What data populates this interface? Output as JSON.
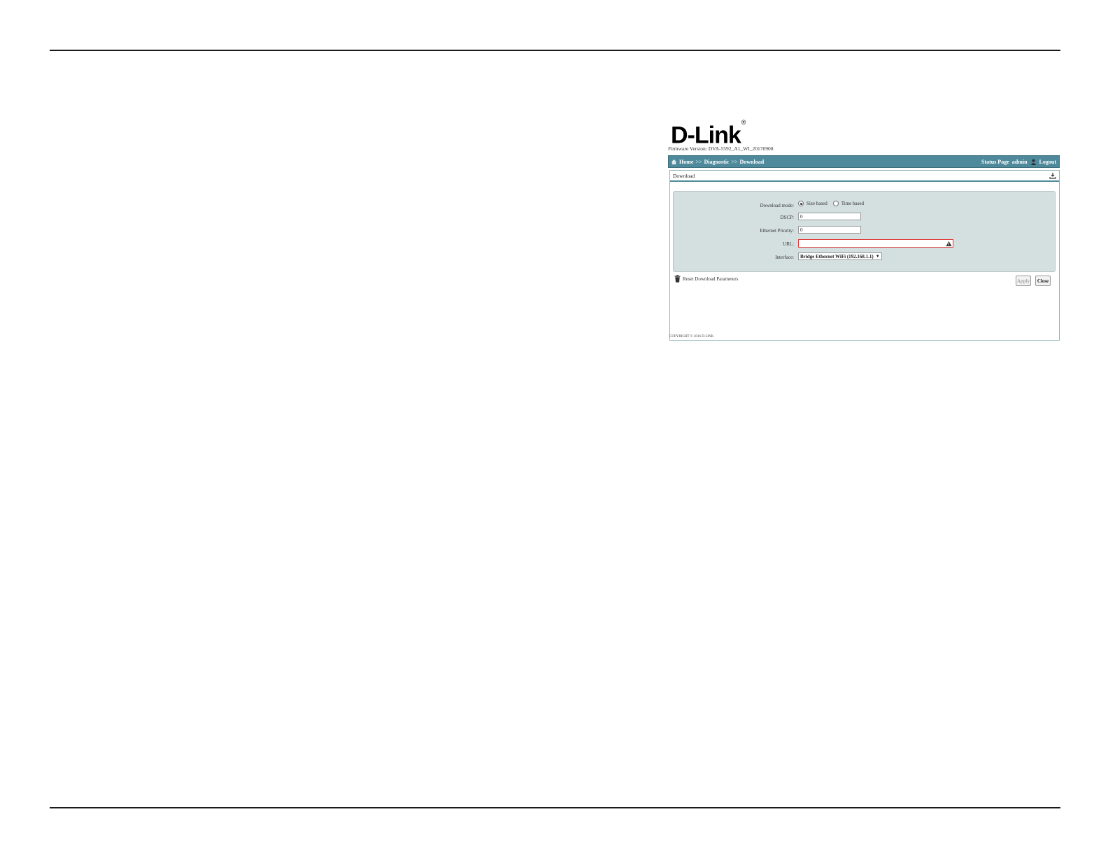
{
  "brand": {
    "logo_text": "D-Link",
    "registered_mark": "®"
  },
  "firmware": "Firmware Version: DVA-5592_A1_WI_20170908",
  "breadcrumb": {
    "home": "Home",
    "sep1": ">>",
    "diagnostic": "Diagnostic",
    "sep2": ">>",
    "download": "Download"
  },
  "topbar": {
    "status_page": "Status Page",
    "user": "admin",
    "logout": "Logout"
  },
  "panel": {
    "title": "Download"
  },
  "form": {
    "download_mode_label": "Download mode:",
    "mode_option_size": "Size based",
    "mode_option_time": "Time based",
    "mode_selected": "Size based",
    "dscp_label": "DSCP:",
    "dscp_value": "0",
    "eth_priority_label": "Ethernet Priority:",
    "eth_priority_value": "0",
    "url_label": "URL:",
    "url_value": "",
    "interface_label": "Interface:",
    "interface_value": "Bridge Ethernet WiFi (192.168.1.1)"
  },
  "actions": {
    "reset": "Reset Download Parameters",
    "apply": "Apply",
    "close": "Close"
  },
  "footer": {
    "copyright": "COPYRIGHT © 2016 D-LINK"
  },
  "colors": {
    "header_bar": "#4e8a9b",
    "form_bg": "#d4dfdf",
    "error_border": "#e03a3a"
  }
}
